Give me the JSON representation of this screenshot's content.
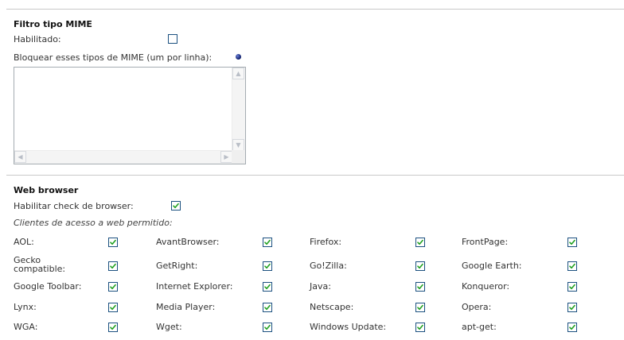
{
  "mime_filter": {
    "title": "Filtro tipo MIME",
    "enabled_label": "Habilitado:",
    "enabled_checked": false,
    "block_label": "Bloquear esses tipos de MIME (um por linha):",
    "block_value": "",
    "info_icon": "info-icon"
  },
  "web_browser": {
    "title": "Web browser",
    "check_label": "Habilitar check de browser:",
    "check_checked": true,
    "allowed_label": "Clientes de acesso a web permitido:",
    "clients": [
      {
        "label": "AOL:",
        "checked": true
      },
      {
        "label": "AvantBrowser:",
        "checked": true
      },
      {
        "label": "Firefox:",
        "checked": true
      },
      {
        "label": "FrontPage:",
        "checked": true
      },
      {
        "label": "Gecko compatible:",
        "checked": true
      },
      {
        "label": "GetRight:",
        "checked": true
      },
      {
        "label": "Go!Zilla:",
        "checked": true
      },
      {
        "label": "Google Earth:",
        "checked": true
      },
      {
        "label": "Google Toolbar:",
        "checked": true
      },
      {
        "label": "Internet Explorer:",
        "checked": true
      },
      {
        "label": "Java:",
        "checked": true
      },
      {
        "label": "Konqueror:",
        "checked": true
      },
      {
        "label": "Lynx:",
        "checked": true
      },
      {
        "label": "Media Player:",
        "checked": true
      },
      {
        "label": "Netscape:",
        "checked": true
      },
      {
        "label": "Opera:",
        "checked": true
      },
      {
        "label": "WGA:",
        "checked": true
      },
      {
        "label": "Wget:",
        "checked": true
      },
      {
        "label": "Windows Update:",
        "checked": true
      },
      {
        "label": "apt-get:",
        "checked": true
      }
    ]
  },
  "colors": {
    "checkbox_border": "#1c5180",
    "checkmark": "#21a121",
    "rule": "#c8c8c8"
  }
}
